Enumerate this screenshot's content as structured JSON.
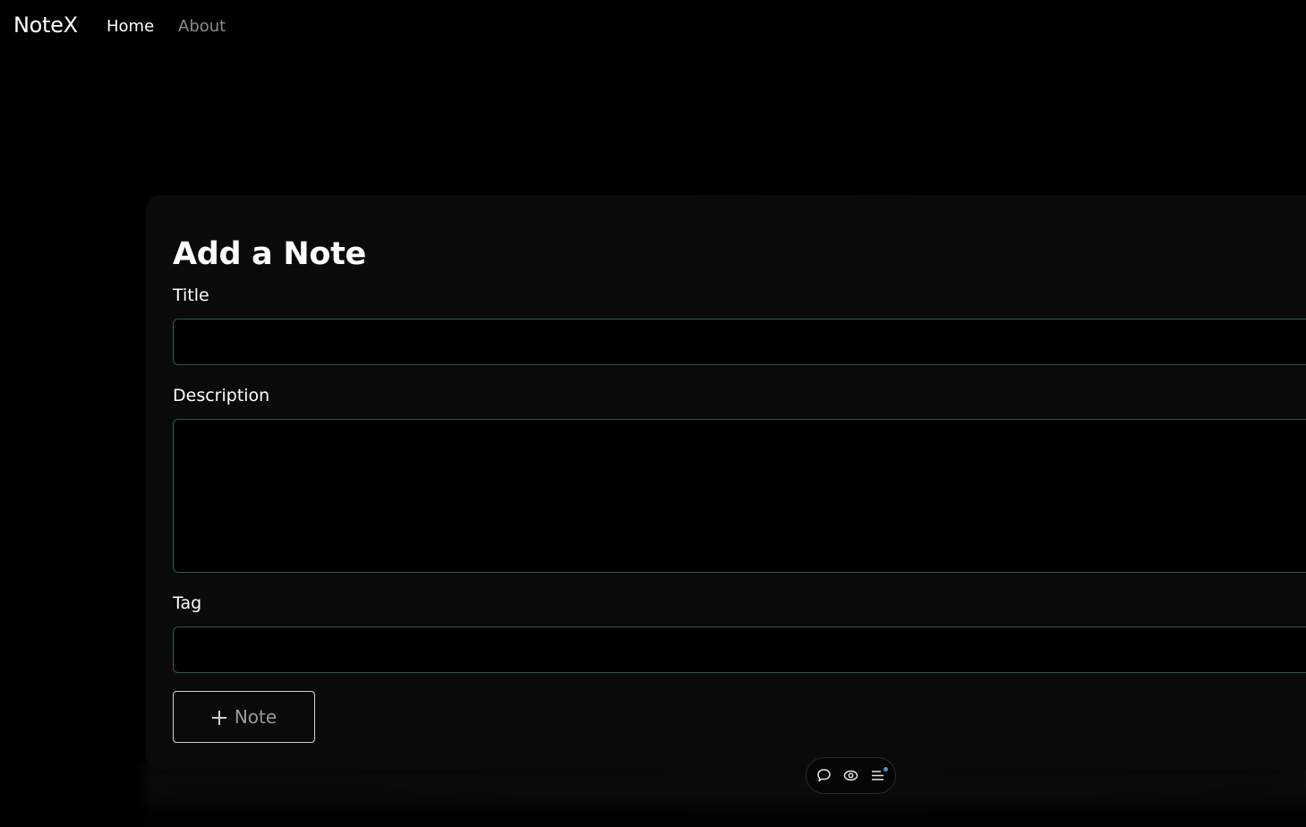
{
  "nav": {
    "brand": "NoteX",
    "links": [
      {
        "label": "Home",
        "active": true
      },
      {
        "label": "About",
        "active": false
      }
    ]
  },
  "form": {
    "heading": "Add a Note",
    "title_label": "Title",
    "title_value": "",
    "description_label": "Description",
    "description_value": "",
    "tag_label": "Tag",
    "tag_value": "",
    "submit_label": "Note",
    "submit_icon": "plus-icon"
  },
  "toolbar": {
    "icons": [
      "comment-icon",
      "eye-icon",
      "list-icon"
    ],
    "notification_dot": true
  },
  "colors": {
    "background": "#000000",
    "card": "#0a0a0a",
    "input_border": "#2b5c45",
    "nav_inactive": "#8c8c8c",
    "button_text": "#9a9a9a",
    "notify_dot": "#4a90e2"
  }
}
